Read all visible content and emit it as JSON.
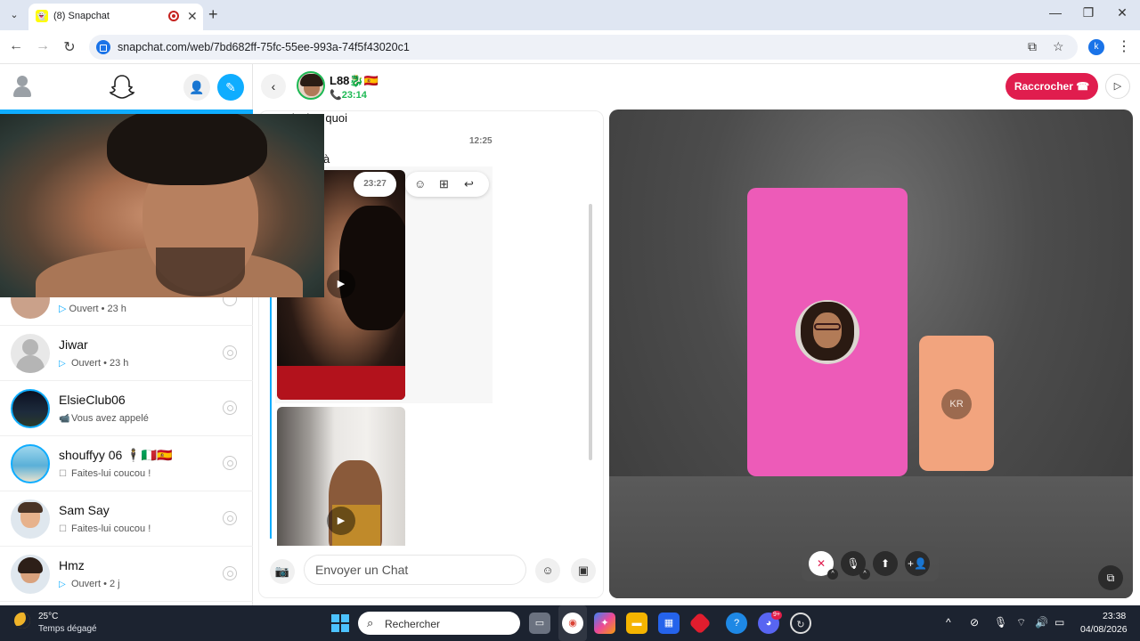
{
  "browser": {
    "tab_title": "(8) Snapchat",
    "tab_favicon": "snapchat-ghost-icon",
    "url": "snapchat.com/web/7bd682ff-75fc-55ee-993a-74f5f43020c1",
    "profile_letter": "k"
  },
  "sidebar": {
    "partial_status": "Ouvert • 23 h",
    "chats": [
      {
        "name": "Jiwar",
        "status": "Ouvert • 23 h",
        "status_icon": "sent-arrow-icon"
      },
      {
        "name": "ElsieClub06",
        "status": "Vous avez appelé",
        "status_icon": "video-call-icon"
      },
      {
        "name": "shouffyy 06 🕴🇮🇹🇪🇸",
        "status": "Faites-lui coucou !",
        "status_icon": "wave-chat-icon"
      },
      {
        "name": "Sam Say",
        "status": "Faites-lui coucou !",
        "status_icon": "wave-chat-icon"
      },
      {
        "name": "Hmz",
        "status": "Ouvert • 2 j",
        "status_icon": "sent-arrow-icon"
      }
    ]
  },
  "conversation": {
    "name": "L88🐉🇪🇸",
    "call_time": "📞23:14",
    "hangup_label": "Raccrocher",
    "messages": {
      "partial_text": "tu devien quoi",
      "timestamp": "12:25",
      "partial_text2": "à",
      "media_time": "23:27"
    },
    "composer_placeholder": "Envoyer un Chat"
  },
  "call": {
    "participant_initials": "KR"
  },
  "taskbar": {
    "temperature": "25°C",
    "weather": "Temps dégagé",
    "search_placeholder": "Rechercher",
    "time": "23:38",
    "date": "04/08/2026",
    "discord_badge": "9+"
  },
  "colors": {
    "snap_blue": "#0fadff",
    "hangup_red": "#e01d4e",
    "call_tile_pink": "#ed5bb8",
    "call_tile_peach": "#f2a47e",
    "online_green": "#1db954"
  }
}
